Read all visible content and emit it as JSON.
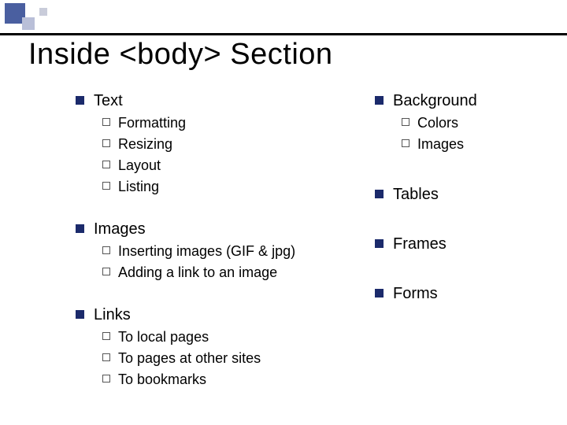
{
  "title": "Inside <body> Section",
  "left": [
    {
      "label": "Text",
      "subs": [
        "Formatting",
        "Resizing",
        "Layout",
        "Listing"
      ]
    },
    {
      "label": "Images",
      "subs": [
        "Inserting images (GIF & jpg)",
        "Adding a link to an image"
      ]
    },
    {
      "label": "Links",
      "subs": [
        "To local pages",
        "To pages at other sites",
        "To bookmarks"
      ]
    }
  ],
  "right": [
    {
      "label": "Background",
      "subs": [
        "Colors",
        "Images"
      ]
    },
    {
      "label": "Tables",
      "subs": []
    },
    {
      "label": "Frames",
      "subs": []
    },
    {
      "label": "Forms",
      "subs": []
    }
  ],
  "colors": {
    "bullet": "#1b2a6b",
    "deco_primary": "#4a5fa0",
    "deco_light": "#b9bfd8"
  }
}
